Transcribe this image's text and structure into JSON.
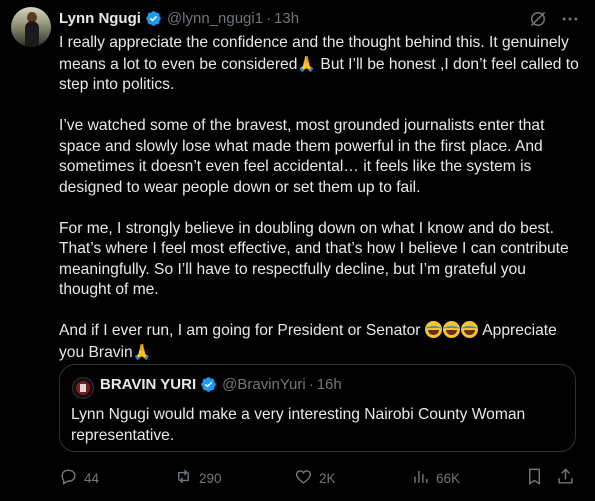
{
  "author": {
    "name": "Lynn Ngugi",
    "handle": "@lynn_ngugi1",
    "separator": "·",
    "time": "13h"
  },
  "body": {
    "p1_a": "I really appreciate the confidence and the thought behind this. It genuinely means a lot to even be considered",
    "p1_b": " But I’ll be honest ,I don’t feel called to step into politics.",
    "p2": "I’ve watched some of the bravest, most grounded journalists enter that space and slowly lose what made them powerful in the first place. And sometimes it doesn’t even feel accidental… it feels like the system is designed to wear people down or set them up to fail.",
    "p3": "For me, I strongly believe in doubling down on what I know and do best. That’s where I feel most effective, and that’s how I believe I can contribute meaningfully. So I’ll have to respectfully decline, but I’m grateful you thought of me.",
    "p4_a": "And if I ever run, I am going for President or Senator ",
    "p4_b": " Appreciate you Bravin",
    "pray_emoji": "🙏",
    "laugh_emoji": "😂"
  },
  "quote": {
    "name": "BRAVIN YURI",
    "handle": "@BravinYuri",
    "separator": "·",
    "time": "16h",
    "text": "Lynn Ngugi would make a very interesting Nairobi County Woman representative."
  },
  "actions": {
    "replies": "44",
    "reposts": "290",
    "likes": "2K",
    "views": "66K"
  },
  "icons": {
    "verified": "verified-badge-icon",
    "grok": "grok-icon",
    "more": "more-icon",
    "reply": "reply-icon",
    "repost": "repost-icon",
    "like": "heart-icon",
    "views": "views-icon",
    "bookmark": "bookmark-icon",
    "share": "share-icon"
  },
  "colors": {
    "background": "#000000",
    "text": "#e7e9ea",
    "muted": "#71767b",
    "verified": "#1d9bf0",
    "border": "#2f3336"
  }
}
